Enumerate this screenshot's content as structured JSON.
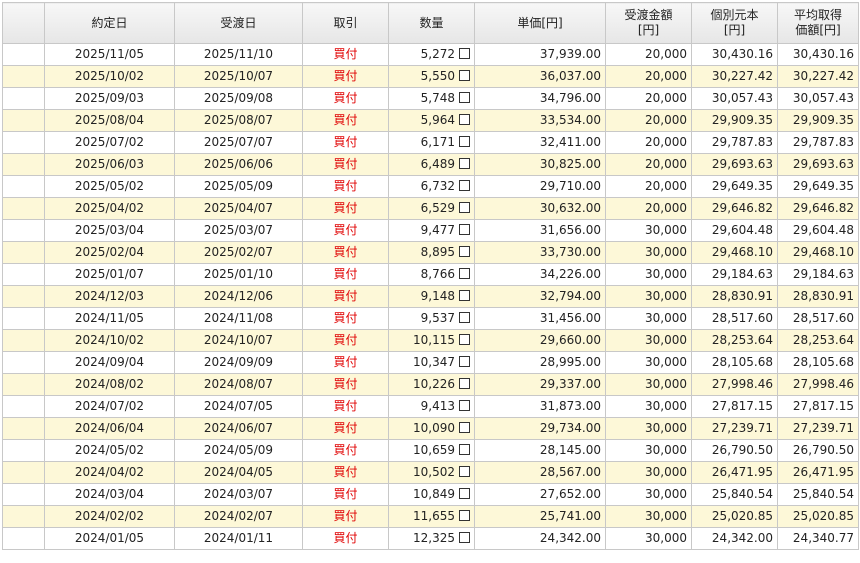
{
  "headers": {
    "blank": "",
    "yakujobi": "約定日",
    "ukewatashibi": "受渡日",
    "torihiki": "取引",
    "suryo": "数量",
    "tanka": "単価[円]",
    "ukewatashi_kingaku_1": "受渡金額",
    "ukewatashi_kingaku_2": "[円]",
    "kobetsu_1": "個別元本",
    "kobetsu_2": "[円]",
    "heikin_1": "平均取得",
    "heikin_2": "価額[円]"
  },
  "rows": [
    {
      "yakujobi": "2025/11/05",
      "ukewatashibi": "2025/11/10",
      "torihiki": "買付",
      "suryo": "5,272",
      "tanka": "37,939.00",
      "kingaku": "20,000",
      "kobetsu": "30,430.16",
      "heikin": "30,430.16"
    },
    {
      "yakujobi": "2025/10/02",
      "ukewatashibi": "2025/10/07",
      "torihiki": "買付",
      "suryo": "5,550",
      "tanka": "36,037.00",
      "kingaku": "20,000",
      "kobetsu": "30,227.42",
      "heikin": "30,227.42"
    },
    {
      "yakujobi": "2025/09/03",
      "ukewatashibi": "2025/09/08",
      "torihiki": "買付",
      "suryo": "5,748",
      "tanka": "34,796.00",
      "kingaku": "20,000",
      "kobetsu": "30,057.43",
      "heikin": "30,057.43"
    },
    {
      "yakujobi": "2025/08/04",
      "ukewatashibi": "2025/08/07",
      "torihiki": "買付",
      "suryo": "5,964",
      "tanka": "33,534.00",
      "kingaku": "20,000",
      "kobetsu": "29,909.35",
      "heikin": "29,909.35"
    },
    {
      "yakujobi": "2025/07/02",
      "ukewatashibi": "2025/07/07",
      "torihiki": "買付",
      "suryo": "6,171",
      "tanka": "32,411.00",
      "kingaku": "20,000",
      "kobetsu": "29,787.83",
      "heikin": "29,787.83"
    },
    {
      "yakujobi": "2025/06/03",
      "ukewatashibi": "2025/06/06",
      "torihiki": "買付",
      "suryo": "6,489",
      "tanka": "30,825.00",
      "kingaku": "20,000",
      "kobetsu": "29,693.63",
      "heikin": "29,693.63"
    },
    {
      "yakujobi": "2025/05/02",
      "ukewatashibi": "2025/05/09",
      "torihiki": "買付",
      "suryo": "6,732",
      "tanka": "29,710.00",
      "kingaku": "20,000",
      "kobetsu": "29,649.35",
      "heikin": "29,649.35"
    },
    {
      "yakujobi": "2025/04/02",
      "ukewatashibi": "2025/04/07",
      "torihiki": "買付",
      "suryo": "6,529",
      "tanka": "30,632.00",
      "kingaku": "20,000",
      "kobetsu": "29,646.82",
      "heikin": "29,646.82"
    },
    {
      "yakujobi": "2025/03/04",
      "ukewatashibi": "2025/03/07",
      "torihiki": "買付",
      "suryo": "9,477",
      "tanka": "31,656.00",
      "kingaku": "30,000",
      "kobetsu": "29,604.48",
      "heikin": "29,604.48"
    },
    {
      "yakujobi": "2025/02/04",
      "ukewatashibi": "2025/02/07",
      "torihiki": "買付",
      "suryo": "8,895",
      "tanka": "33,730.00",
      "kingaku": "30,000",
      "kobetsu": "29,468.10",
      "heikin": "29,468.10"
    },
    {
      "yakujobi": "2025/01/07",
      "ukewatashibi": "2025/01/10",
      "torihiki": "買付",
      "suryo": "8,766",
      "tanka": "34,226.00",
      "kingaku": "30,000",
      "kobetsu": "29,184.63",
      "heikin": "29,184.63"
    },
    {
      "yakujobi": "2024/12/03",
      "ukewatashibi": "2024/12/06",
      "torihiki": "買付",
      "suryo": "9,148",
      "tanka": "32,794.00",
      "kingaku": "30,000",
      "kobetsu": "28,830.91",
      "heikin": "28,830.91"
    },
    {
      "yakujobi": "2024/11/05",
      "ukewatashibi": "2024/11/08",
      "torihiki": "買付",
      "suryo": "9,537",
      "tanka": "31,456.00",
      "kingaku": "30,000",
      "kobetsu": "28,517.60",
      "heikin": "28,517.60"
    },
    {
      "yakujobi": "2024/10/02",
      "ukewatashibi": "2024/10/07",
      "torihiki": "買付",
      "suryo": "10,115",
      "tanka": "29,660.00",
      "kingaku": "30,000",
      "kobetsu": "28,253.64",
      "heikin": "28,253.64"
    },
    {
      "yakujobi": "2024/09/04",
      "ukewatashibi": "2024/09/09",
      "torihiki": "買付",
      "suryo": "10,347",
      "tanka": "28,995.00",
      "kingaku": "30,000",
      "kobetsu": "28,105.68",
      "heikin": "28,105.68"
    },
    {
      "yakujobi": "2024/08/02",
      "ukewatashibi": "2024/08/07",
      "torihiki": "買付",
      "suryo": "10,226",
      "tanka": "29,337.00",
      "kingaku": "30,000",
      "kobetsu": "27,998.46",
      "heikin": "27,998.46"
    },
    {
      "yakujobi": "2024/07/02",
      "ukewatashibi": "2024/07/05",
      "torihiki": "買付",
      "suryo": "9,413",
      "tanka": "31,873.00",
      "kingaku": "30,000",
      "kobetsu": "27,817.15",
      "heikin": "27,817.15"
    },
    {
      "yakujobi": "2024/06/04",
      "ukewatashibi": "2024/06/07",
      "torihiki": "買付",
      "suryo": "10,090",
      "tanka": "29,734.00",
      "kingaku": "30,000",
      "kobetsu": "27,239.71",
      "heikin": "27,239.71"
    },
    {
      "yakujobi": "2024/05/02",
      "ukewatashibi": "2024/05/09",
      "torihiki": "買付",
      "suryo": "10,659",
      "tanka": "28,145.00",
      "kingaku": "30,000",
      "kobetsu": "26,790.50",
      "heikin": "26,790.50"
    },
    {
      "yakujobi": "2024/04/02",
      "ukewatashibi": "2024/04/05",
      "torihiki": "買付",
      "suryo": "10,502",
      "tanka": "28,567.00",
      "kingaku": "30,000",
      "kobetsu": "26,471.95",
      "heikin": "26,471.95"
    },
    {
      "yakujobi": "2024/03/04",
      "ukewatashibi": "2024/03/07",
      "torihiki": "買付",
      "suryo": "10,849",
      "tanka": "27,652.00",
      "kingaku": "30,000",
      "kobetsu": "25,840.54",
      "heikin": "25,840.54"
    },
    {
      "yakujobi": "2024/02/02",
      "ukewatashibi": "2024/02/07",
      "torihiki": "買付",
      "suryo": "11,655",
      "tanka": "25,741.00",
      "kingaku": "30,000",
      "kobetsu": "25,020.85",
      "heikin": "25,020.85"
    },
    {
      "yakujobi": "2024/01/05",
      "ukewatashibi": "2024/01/11",
      "torihiki": "買付",
      "suryo": "12,325",
      "tanka": "24,342.00",
      "kingaku": "30,000",
      "kobetsu": "24,342.00",
      "heikin": "24,340.77"
    }
  ],
  "colors": {
    "buy_text": "#e00000",
    "row_stripe": "#fdf8d8",
    "border": "#c8c8c8",
    "header_bg": "#eeeeee"
  },
  "icons": {
    "row_checkbox": "checkbox-icon"
  }
}
